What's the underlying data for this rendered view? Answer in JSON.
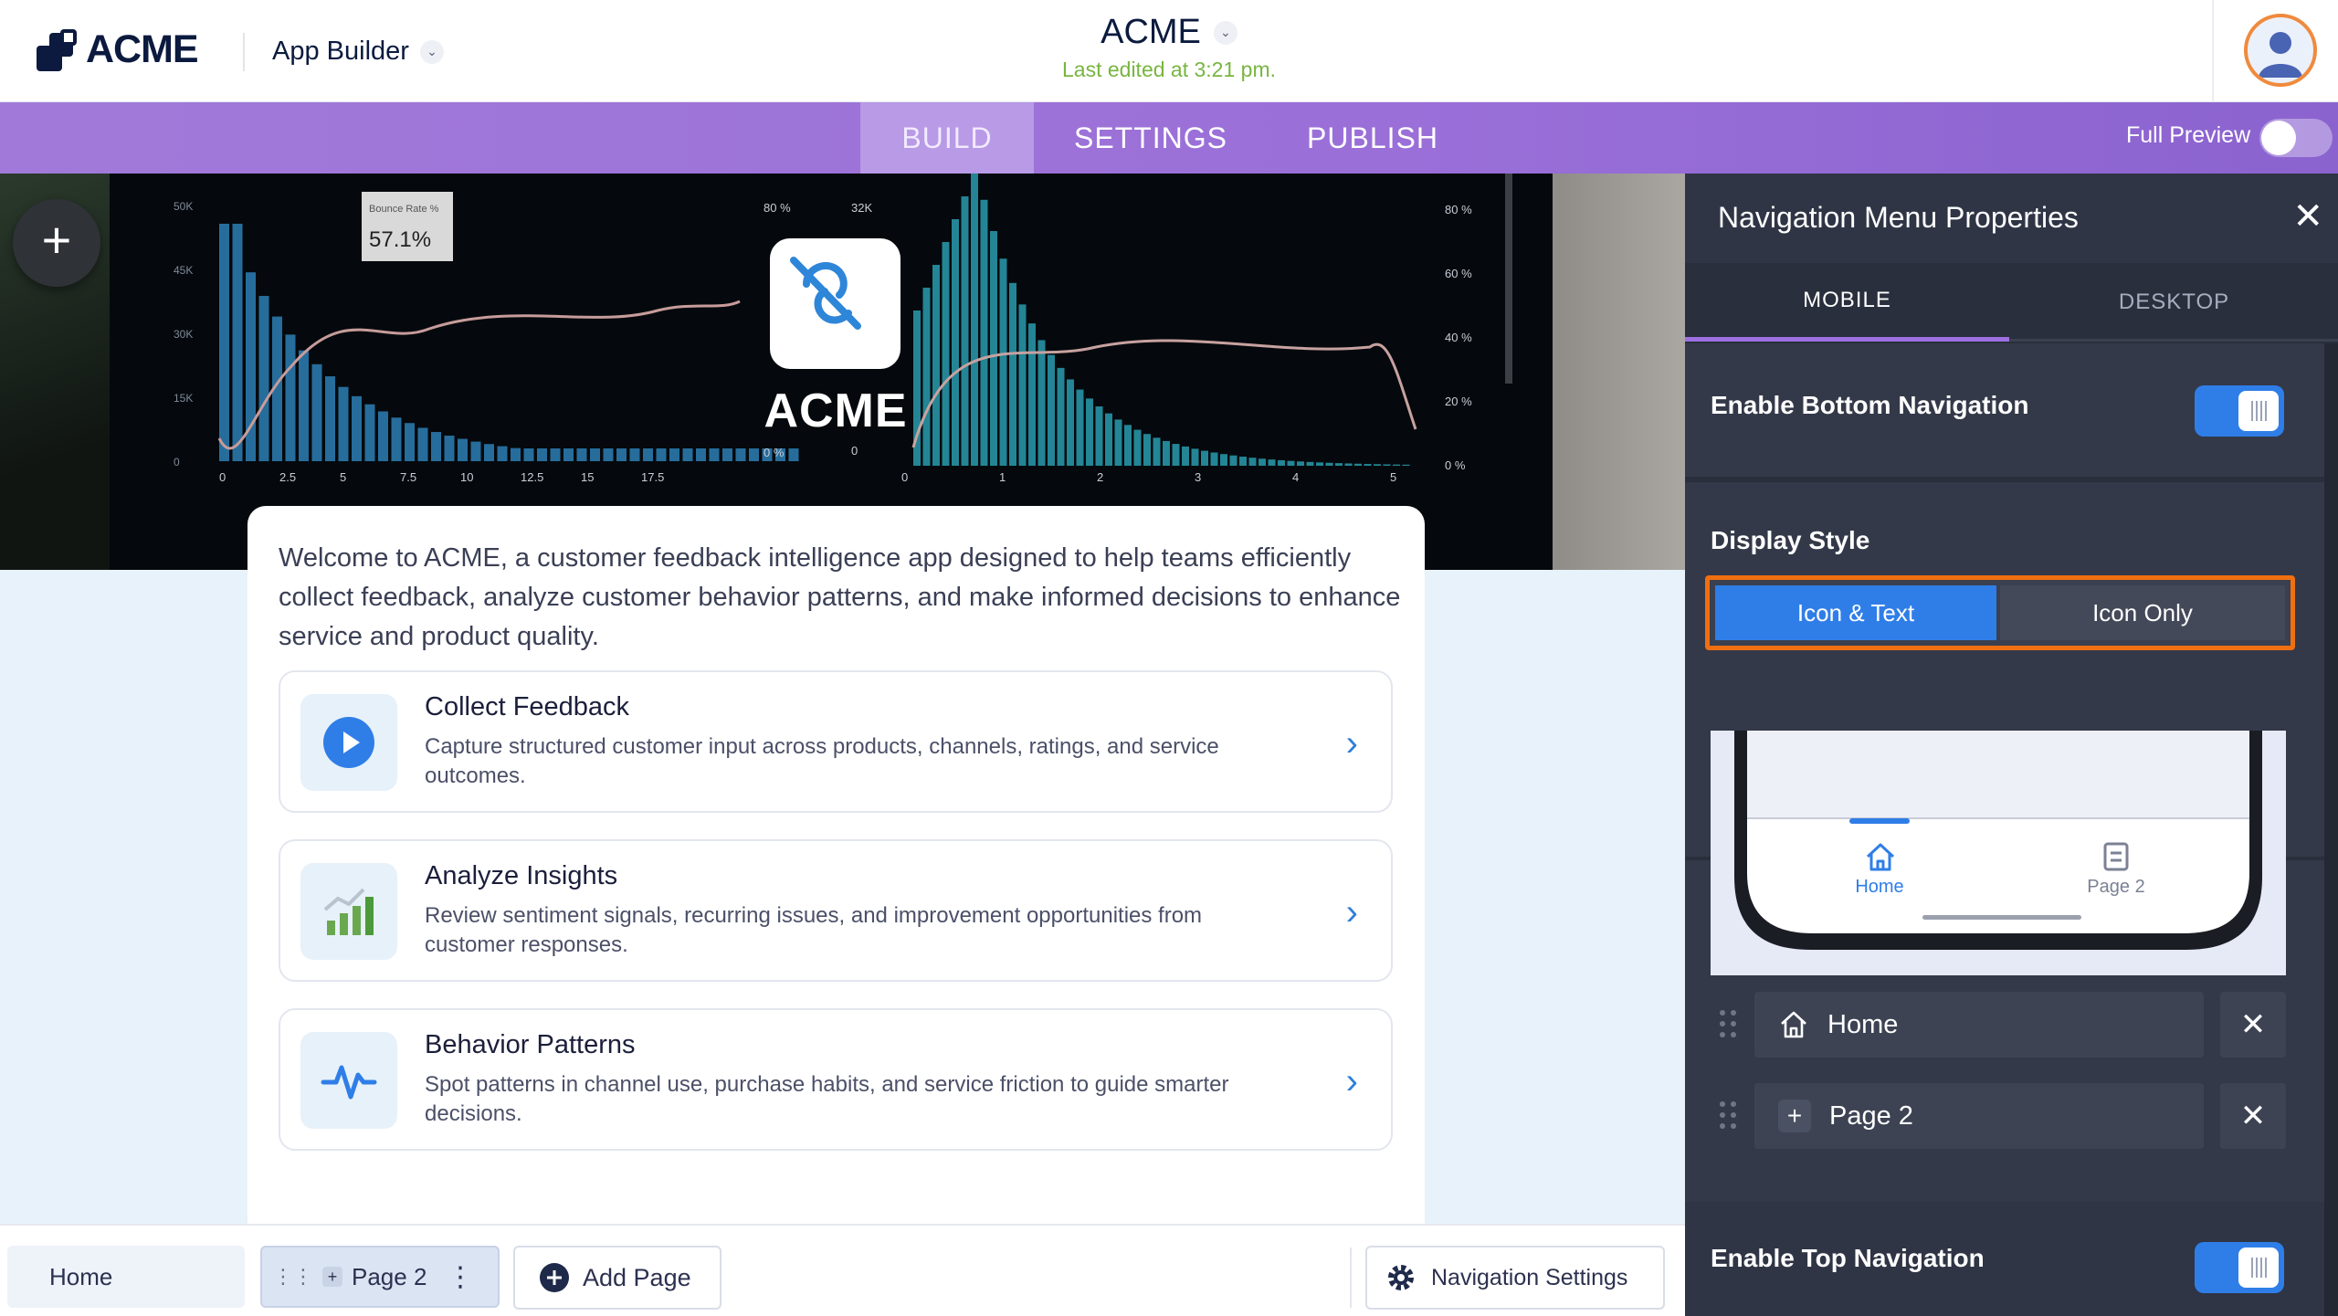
{
  "header": {
    "logo_text": "ACME",
    "app_builder_label": "App Builder",
    "app_title": "ACME",
    "last_edited": "Last edited at 3:21 pm."
  },
  "nav_tabs": [
    {
      "label": "BUILD",
      "active": true
    },
    {
      "label": "SETTINGS",
      "active": false
    },
    {
      "label": "PUBLISH",
      "active": false
    }
  ],
  "full_preview": {
    "label": "Full Preview",
    "enabled": false
  },
  "hero": {
    "app_name": "ACME",
    "chart_labels": {
      "bounce_rate_label": "Bounce Rate %",
      "bounce_rate_value": "57.1%",
      "left_y_ticks": [
        "50K",
        "45K",
        "30K",
        "15K",
        "0"
      ],
      "left_x_ticks": [
        "0",
        "2.5",
        "5",
        "7.5",
        "10",
        "12.5",
        "15",
        "17.5"
      ],
      "mid_y_ticks": [
        "80 %",
        "0 %"
      ],
      "right_y_left_ticks": [
        "32K",
        "0"
      ],
      "right_x_ticks": [
        "0",
        "1",
        "2",
        "3",
        "4",
        "5"
      ],
      "right_y_ticks": [
        "80 %",
        "60 %",
        "40 %",
        "20 %",
        "0 %"
      ]
    }
  },
  "intro_text": "Welcome to ACME, a customer feedback intelligence app designed to help teams efficiently collect feedback, analyze customer behavior patterns, and make informed decisions to enhance service and product quality.",
  "features": [
    {
      "title": "Collect Feedback",
      "description": "Capture structured customer input across products, channels, ratings, and service outcomes.",
      "icon": "play-circle-icon"
    },
    {
      "title": "Analyze Insights",
      "description": "Review sentiment signals, recurring issues, and improvement opportunities from customer responses.",
      "icon": "bar-chart-icon"
    },
    {
      "title": "Behavior Patterns",
      "description": "Spot patterns in channel use, purchase habits, and service friction to guide smarter decisions.",
      "icon": "pulse-icon"
    }
  ],
  "page_bar": {
    "home": "Home",
    "page2": "Page 2",
    "add_page": "Add Page",
    "navigation_settings": "Navigation Settings"
  },
  "panel": {
    "title": "Navigation Menu Properties",
    "tabs": [
      {
        "label": "MOBILE",
        "active": true
      },
      {
        "label": "DESKTOP",
        "active": false
      }
    ],
    "enable_bottom_nav": {
      "label": "Enable Bottom Navigation",
      "enabled": true
    },
    "display_style": {
      "label": "Display Style",
      "options": [
        "Icon & Text",
        "Icon Only"
      ],
      "selected": "Icon & Text"
    },
    "preview": {
      "items": [
        "Home",
        "Page 2"
      ],
      "active": "Home"
    },
    "nav_items": [
      {
        "label": "Home",
        "icon": "home-icon"
      },
      {
        "label": "Page 2",
        "icon": "plus-icon"
      }
    ],
    "enable_top_nav": {
      "label": "Enable Top Navigation",
      "enabled": true
    }
  },
  "colors": {
    "purple_bar": "#9a6fd8",
    "accent_blue": "#2f7ee8",
    "highlight_orange": "#f06f10",
    "edited_green": "#78b540",
    "panel_bg": "#2a2f3d"
  }
}
